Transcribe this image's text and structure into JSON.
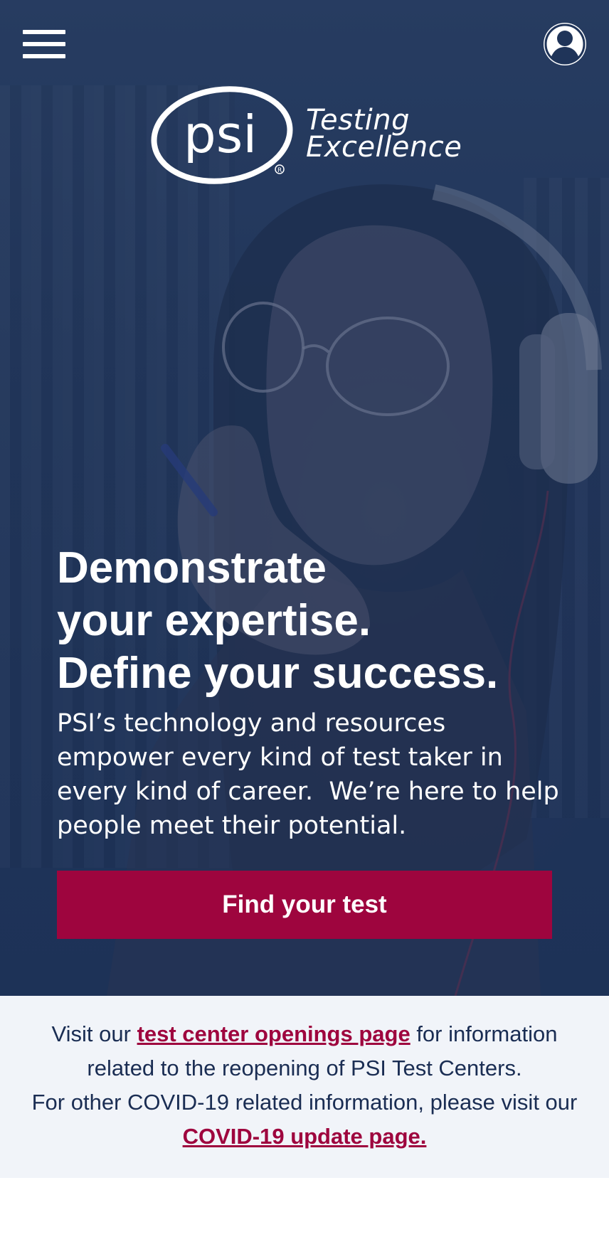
{
  "header": {
    "menu_icon": "hamburger-menu-icon",
    "account_icon": "user-account-icon"
  },
  "logo": {
    "mark": "psi",
    "tagline_line1": "Testing",
    "tagline_line2": "Excellence"
  },
  "hero": {
    "headline_line1": "Demonstrate",
    "headline_line2": "your expertise.",
    "headline_line3": "Define your success.",
    "body_line1": "PSI’s technology and resources",
    "body_line2": "empower every kind of test taker in",
    "body_line3": "every kind of career.  We’re here to help",
    "body_line4": "people meet their potential.",
    "cta_label": "Find your test"
  },
  "notice": {
    "line1_prefix": "Visit our ",
    "line1_link": "test center openings page",
    "line1_suffix": " for information",
    "line2": "related to the reopening of PSI Test Centers.",
    "line3": "For other COVID-19 related information, please visit our",
    "line4_link": "COVID-19 update page."
  },
  "colors": {
    "accent": "#9e053e",
    "hero_overlay": "#1f3459",
    "notice_bg": "#f1f4f9",
    "notice_text": "#1a2d53"
  }
}
